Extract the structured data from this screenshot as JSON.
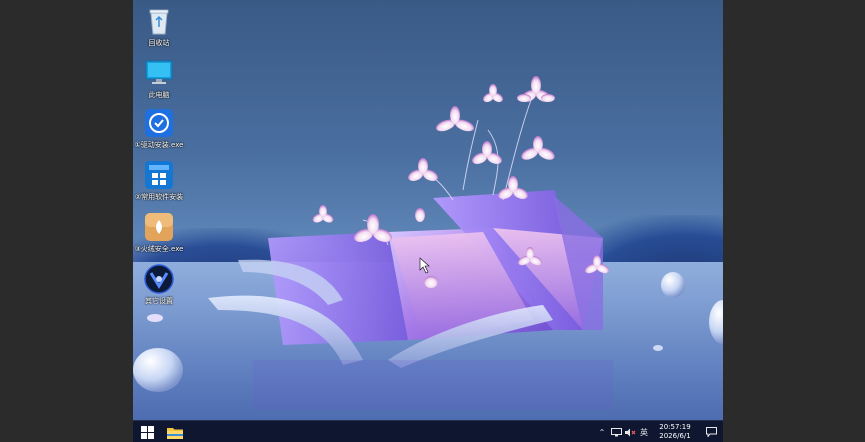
{
  "desktop": {
    "icons": [
      {
        "label": "回收站",
        "icon": "recycle-bin-icon"
      },
      {
        "label": "此电脑",
        "icon": "computer-icon"
      },
      {
        "label": "①驱动安装.exe",
        "icon": "driver-install-icon"
      },
      {
        "label": "②常用软件安装",
        "icon": "software-install-icon"
      },
      {
        "label": "③火绒安全.exe",
        "icon": "huorong-security-icon"
      },
      {
        "label": "其它设置",
        "icon": "other-settings-icon"
      }
    ]
  },
  "taskbar": {
    "start_icon": "windows-start-icon",
    "pinned": [
      {
        "icon": "file-explorer-icon"
      }
    ],
    "tray": {
      "ime_label": "英",
      "time": "20:57:19",
      "date": "2026/6/1"
    }
  },
  "colors": {
    "taskbar_bg": "#0f1730",
    "accent": "#0078d4"
  }
}
